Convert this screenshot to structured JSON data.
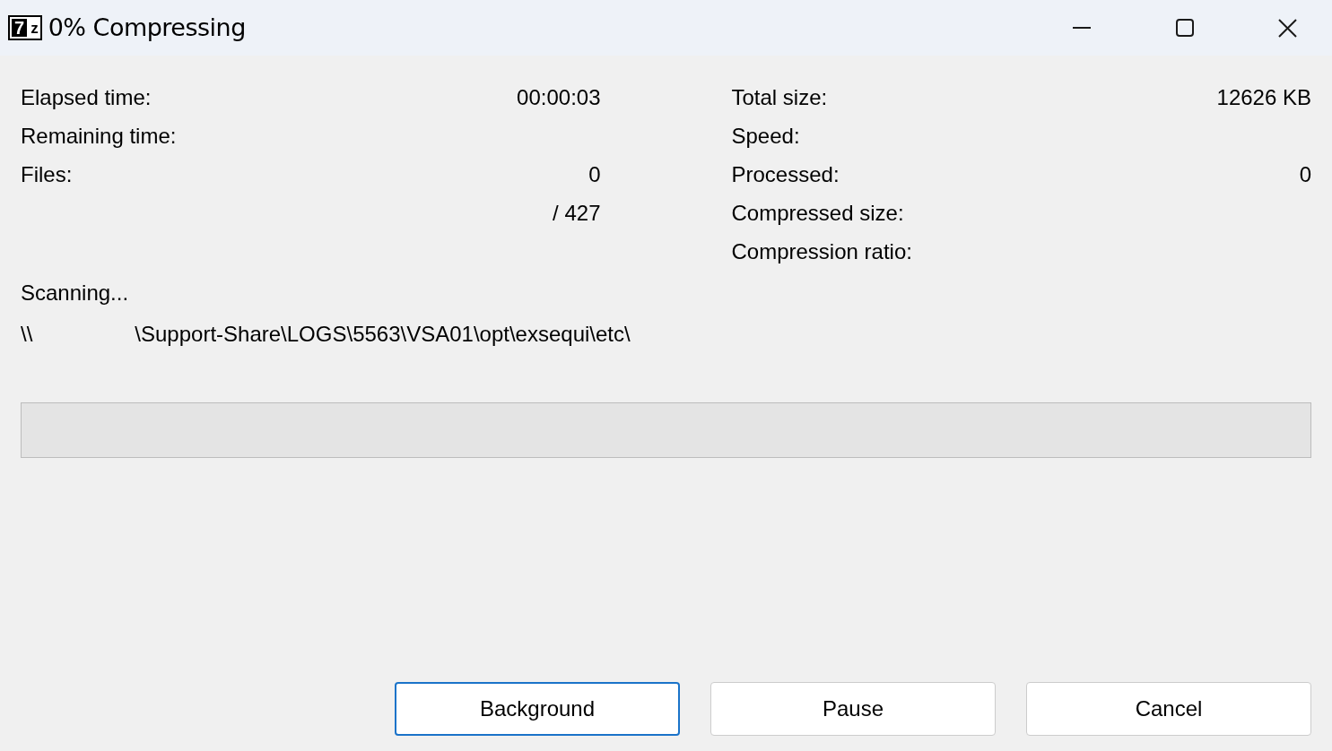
{
  "window": {
    "title": "0% Compressing",
    "app_icon": {
      "glyphs": [
        "7",
        "z"
      ]
    }
  },
  "stats_left": [
    {
      "label": "Elapsed time:",
      "value": "00:00:03"
    },
    {
      "label": "Remaining time:"
    },
    {
      "label": "Files:",
      "value": "0"
    },
    {
      "value": "/ 427"
    }
  ],
  "stats_right": [
    {
      "label": "Total size:",
      "value": "12626 KB"
    },
    {
      "label": "Speed:"
    },
    {
      "label": "Processed:",
      "value": "0"
    },
    {
      "label": "Compressed size:"
    },
    {
      "label": "Compression ratio:"
    }
  ],
  "status": {
    "text": "Scanning...",
    "path_parts": [
      "\\\\",
      "\\Support-Share\\LOGS\\5563\\VSA01\\opt\\exsequi\\etc\\"
    ]
  },
  "progress": {
    "level": 0
  },
  "buttons": [
    {
      "label": "Background",
      "focused": true
    },
    {
      "label": "Pause",
      "focused": false
    },
    {
      "label": "Cancel",
      "focused": false
    }
  ]
}
